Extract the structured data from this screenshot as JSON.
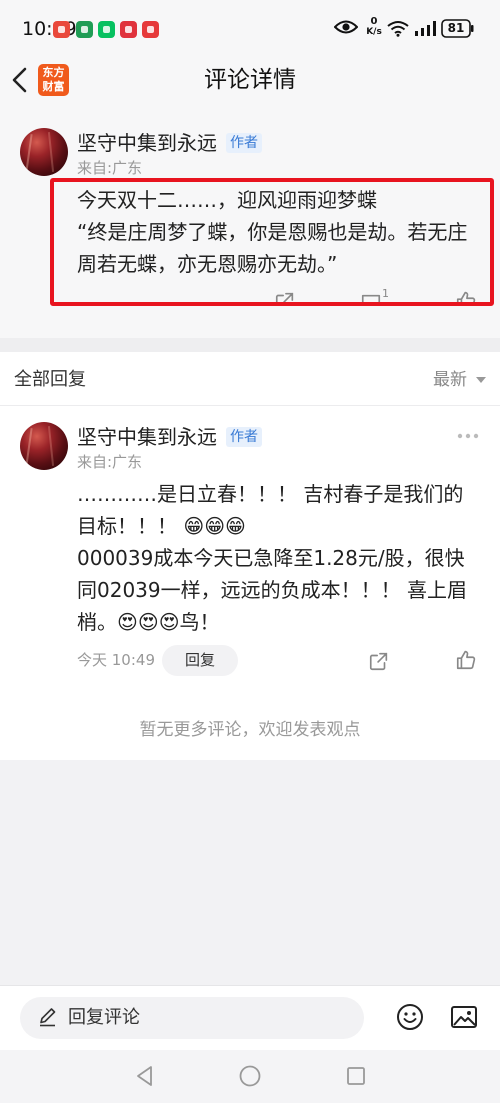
{
  "status_bar": {
    "time": "10:49",
    "net_speed_value": "0",
    "net_speed_unit": "K/s",
    "battery_level": "81",
    "notification_icons": [
      {
        "name": "red-app-notification-icon",
        "color": "#e9483b"
      },
      {
        "name": "green-app-notification-icon",
        "color": "#1f9d55"
      },
      {
        "name": "wechat-notification-icon",
        "color": "#07c160"
      },
      {
        "name": "red-app-notification-icon",
        "color": "#e0323c"
      },
      {
        "name": "red-app-notification-icon",
        "color": "#e6393a"
      }
    ],
    "indicator_icons": [
      "eye-icon",
      "wifi-icon",
      "signal-icon",
      "battery-icon"
    ]
  },
  "header": {
    "back_icon": "chevron-left-icon",
    "logo_text": [
      "东方",
      "财富"
    ],
    "title": "评论详情"
  },
  "main_comment": {
    "author": "坚守中集到永远",
    "badge": "作者",
    "location": "来自:广东",
    "lines": [
      "今天双十二……，迎风迎雨迎梦蝶",
      "“终是庄周梦了蝶，你是恩赐也是劫。若无庄",
      "周若无蝶，亦无恩赐亦无劫。”"
    ],
    "comment_count": "1",
    "action_icons": [
      "share-icon",
      "comment-icon",
      "like-icon"
    ]
  },
  "replies_section": {
    "title": "全部回复",
    "sort_label": "最新"
  },
  "replies": [
    {
      "author": "坚守中集到永远",
      "badge": "作者",
      "location": "来自:广东",
      "lines": [
        "…………是日立春！！！ 吉村春子是我们的",
        "目标！！！ 😁😁😁",
        "000039成本今天已急降至1.28元/股，很快",
        "同02039一样，远远的负成本！！！ 喜上眉",
        "梢。😍😍😍鸟！"
      ],
      "time": "今天 10:49",
      "reply_label": "回复"
    }
  ],
  "empty_hint": "暂无更多评论，欢迎发表观点",
  "composer": {
    "placeholder": "回复评论",
    "icons": [
      "pencil-icon",
      "emoji-icon",
      "image-icon"
    ]
  },
  "nav_bar": {
    "icons": [
      "nav-back-icon",
      "nav-home-icon",
      "nav-recents-icon"
    ]
  },
  "colors": {
    "brand_orange": "#f05a1c",
    "badge_blue": "#3a7bd5",
    "highlight_red": "#e8141f",
    "text_primary": "#222222",
    "text_secondary": "#999999"
  }
}
